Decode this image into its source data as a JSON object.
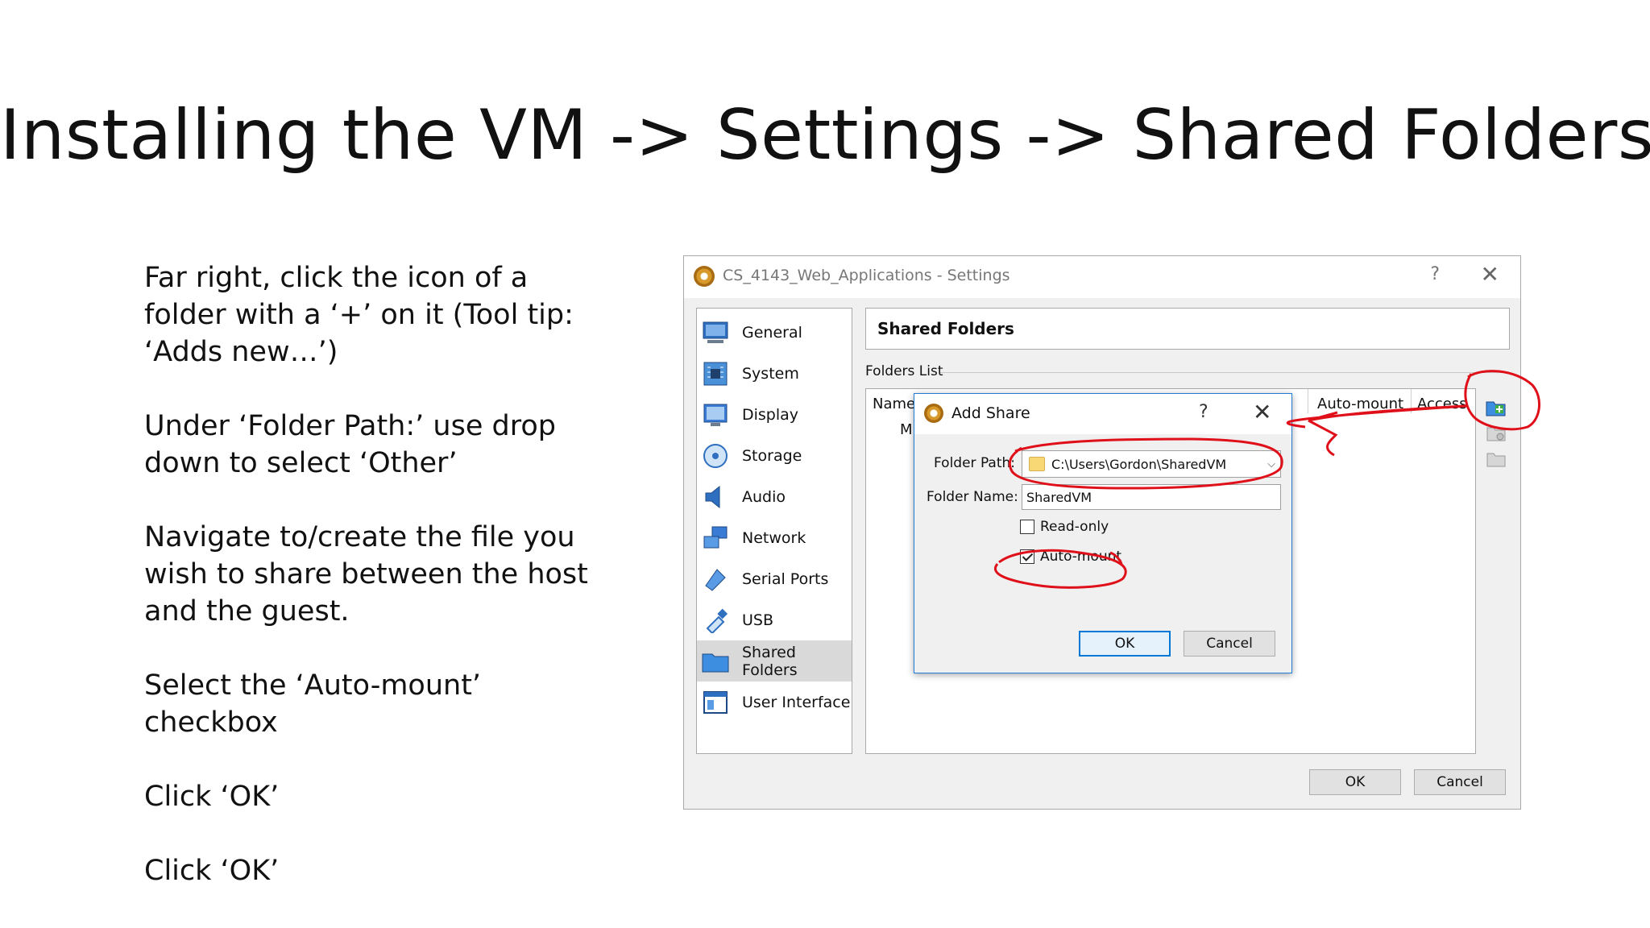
{
  "slide": {
    "title": "Installing the VM -> Settings -> Shared Folders",
    "instructions": [
      "Far right, click the icon of a folder with a ‘+’ on it (Tool tip: ‘Adds new…’)",
      "Under ‘Folder Path:’ use drop down to select ‘Other’",
      "Navigate to/create the file you wish to share between the host and the guest.",
      "Select the ‘Auto-mount’ checkbox",
      "Click ‘OK’",
      "Click ‘OK’"
    ]
  },
  "settings_window": {
    "title": "CS_4143_Web_Applications - Settings",
    "help": "?",
    "close": "✕",
    "nav": [
      {
        "label": "General",
        "icon": "general-icon"
      },
      {
        "label": "System",
        "icon": "system-icon"
      },
      {
        "label": "Display",
        "icon": "display-icon"
      },
      {
        "label": "Storage",
        "icon": "storage-icon"
      },
      {
        "label": "Audio",
        "icon": "audio-icon"
      },
      {
        "label": "Network",
        "icon": "network-icon"
      },
      {
        "label": "Serial Ports",
        "icon": "serial-ports-icon"
      },
      {
        "label": "USB",
        "icon": "usb-icon"
      },
      {
        "label": "Shared Folders",
        "icon": "shared-folders-icon",
        "selected": true
      },
      {
        "label": "User Interface",
        "icon": "user-interface-icon"
      }
    ],
    "section_title": "Shared Folders",
    "folders_list_label": "Folders List",
    "columns": {
      "name": "Name",
      "auto_mount": "Auto-mount",
      "access": "Access"
    },
    "row_fragment": "M",
    "ok": "OK",
    "cancel": "Cancel"
  },
  "add_share": {
    "title": "Add Share",
    "help": "?",
    "close": "✕",
    "folder_path_label": "Folder Path:",
    "folder_path_value": "C:\\Users\\Gordon\\SharedVM",
    "folder_name_label": "Folder Name:",
    "folder_name_value": "SharedVM",
    "read_only_label": "Read-only",
    "read_only_checked": false,
    "auto_mount_label": "Auto-mount",
    "auto_mount_checked": true,
    "ok": "OK",
    "cancel": "Cancel"
  },
  "colors": {
    "annotation": "#e0101a",
    "dialog_border": "#1e7bd8",
    "selected_nav": "#d9d9d9"
  }
}
